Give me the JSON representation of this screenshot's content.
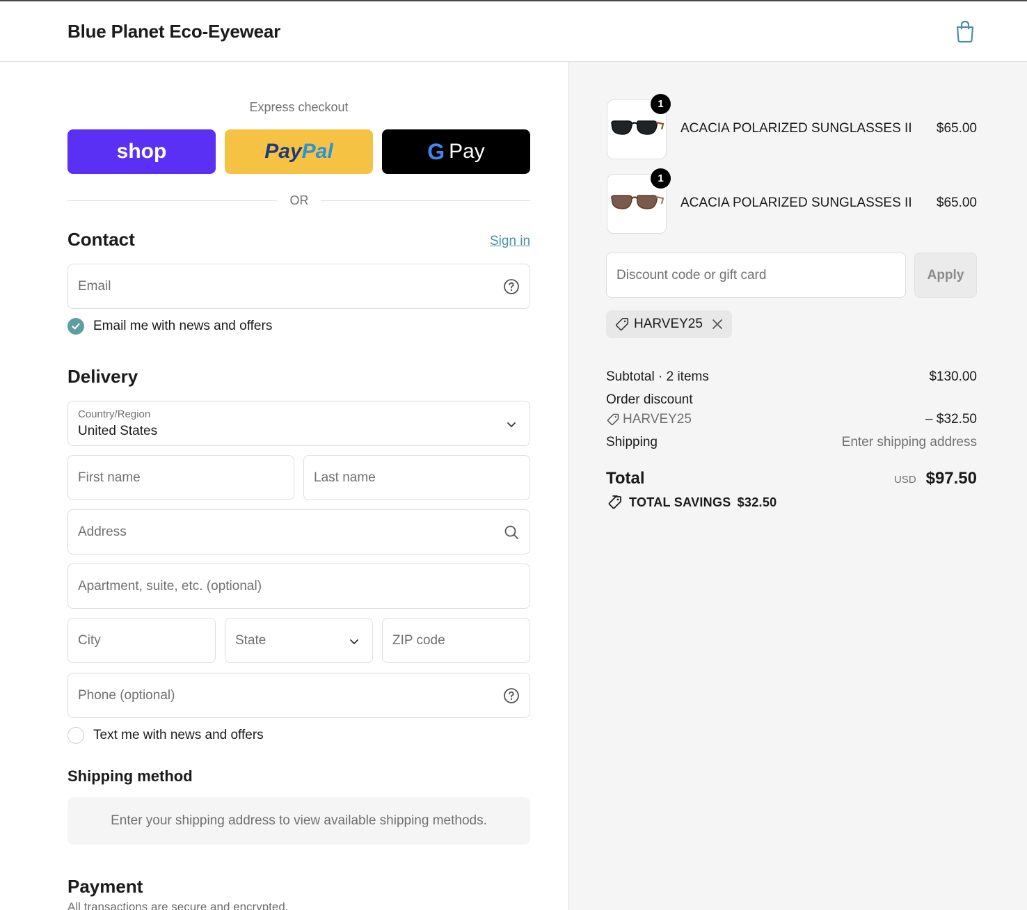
{
  "header": {
    "brand": "Blue Planet Eco-Eyewear",
    "cart_icon": "shopping-bag-icon"
  },
  "express": {
    "title": "Express checkout",
    "shop_label": "shop",
    "paypal_label_1": "Pay",
    "paypal_label_2": "Pal",
    "gpay_g": "G",
    "gpay_label": "Pay",
    "or_text": "OR"
  },
  "contact": {
    "title": "Contact",
    "sign_in": "Sign in",
    "email_placeholder": "Email",
    "email_news_label": "Email me with news and offers",
    "email_news_checked": true
  },
  "delivery": {
    "title": "Delivery",
    "country_label": "Country/Region",
    "country_value": "United States",
    "first_name_placeholder": "First name",
    "last_name_placeholder": "Last name",
    "address_placeholder": "Address",
    "apartment_placeholder": "Apartment, suite, etc. (optional)",
    "city_placeholder": "City",
    "state_placeholder": "State",
    "zip_placeholder": "ZIP code",
    "phone_placeholder": "Phone (optional)",
    "text_news_label": "Text me with news and offers",
    "text_news_checked": false
  },
  "shipping_method": {
    "title": "Shipping method",
    "message": "Enter your shipping address to view available shipping methods."
  },
  "payment": {
    "title": "Payment",
    "description": "All transactions are secure and encrypted."
  },
  "cart": {
    "items": [
      {
        "name": "ACACIA POLARIZED SUNGLASSES II",
        "price": "$65.00",
        "qty": "1"
      },
      {
        "name": "ACACIA POLARIZED SUNGLASSES II",
        "price": "$65.00",
        "qty": "1"
      }
    ],
    "discount_placeholder": "Discount code or gift card",
    "apply_label": "Apply",
    "applied_code": "HARVEY25"
  },
  "summary": {
    "subtotal_label": "Subtotal · 2 items",
    "subtotal_value": "$130.00",
    "discount_label": "Order discount",
    "discount_code": "HARVEY25",
    "discount_value": "– $32.50",
    "shipping_label": "Shipping",
    "shipping_value": "Enter shipping address",
    "total_label": "Total",
    "currency": "USD",
    "total_value": "$97.50",
    "savings_label": "TOTAL SAVINGS",
    "savings_value": "$32.50"
  },
  "colors": {
    "shop": "#5a31f4",
    "paypal": "#f6c244",
    "gpay": "#000000",
    "accent": "#5f9ea0",
    "link": "#4a90a4"
  }
}
